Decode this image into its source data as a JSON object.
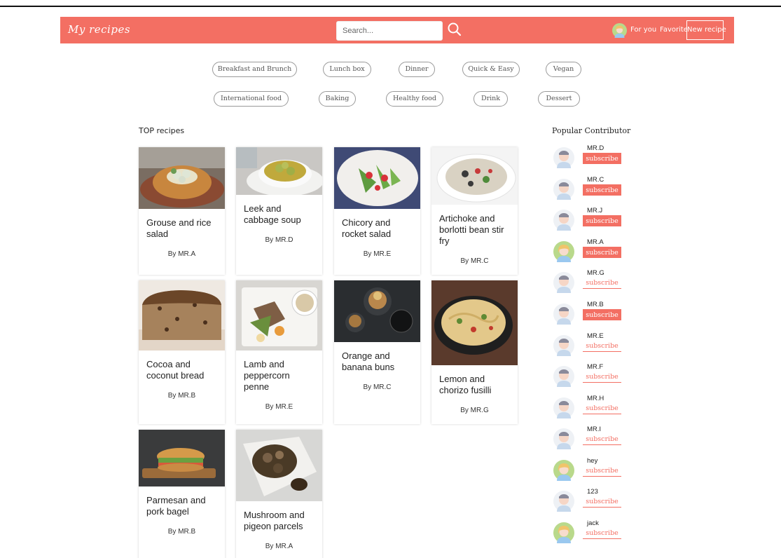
{
  "header": {
    "brand": "My recipes",
    "search_placeholder": "Search...",
    "links": {
      "for_you": "For you",
      "favorite": "Favorite",
      "new_recipe": "New recipe"
    }
  },
  "categories": [
    "Breakfast and Brunch",
    "Lunch box",
    "Dinner",
    "Quick & Easy",
    "Vegan",
    "International food",
    "Baking",
    "Healthy food",
    "Drink",
    "Dessert"
  ],
  "top_recipes": {
    "title": "TOP recipes",
    "items": [
      {
        "title": "Grouse and rice salad",
        "author": "By MR.A"
      },
      {
        "title": "Leek and cabbage soup",
        "author": "By MR.D"
      },
      {
        "title": "Chicory and rocket salad",
        "author": "By MR.E"
      },
      {
        "title": "Artichoke and borlotti bean stir fry",
        "author": "By MR.C"
      },
      {
        "title": "Cocoa and coconut bread",
        "author": "By MR.B"
      },
      {
        "title": "Lamb and peppercorn penne",
        "author": "By MR.E"
      },
      {
        "title": "Orange and banana buns",
        "author": "By MR.C"
      },
      {
        "title": "Lemon and chorizo fusilli",
        "author": "By MR.G"
      },
      {
        "title": "Parmesan and pork bagel",
        "author": "By MR.B"
      },
      {
        "title": "Mushroom and pigeon parcels",
        "author": "By MR.A"
      }
    ]
  },
  "contributors": {
    "title": "Popular Contributor",
    "subscribe_label": "subscribe",
    "items": [
      {
        "name": "MR.D",
        "subscribed": true
      },
      {
        "name": "MR.C",
        "subscribed": true
      },
      {
        "name": "MR.J",
        "subscribed": true
      },
      {
        "name": "MR.A",
        "subscribed": true
      },
      {
        "name": "MR.G",
        "subscribed": false
      },
      {
        "name": "MR.B",
        "subscribed": true
      },
      {
        "name": "MR.E",
        "subscribed": false
      },
      {
        "name": "MR.F",
        "subscribed": false
      },
      {
        "name": "MR.H",
        "subscribed": false
      },
      {
        "name": "MR.I",
        "subscribed": false
      },
      {
        "name": "hey",
        "subscribed": false
      },
      {
        "name": "123",
        "subscribed": false
      },
      {
        "name": "jack",
        "subscribed": false
      }
    ]
  },
  "colors": {
    "accent": "#f36f63"
  }
}
